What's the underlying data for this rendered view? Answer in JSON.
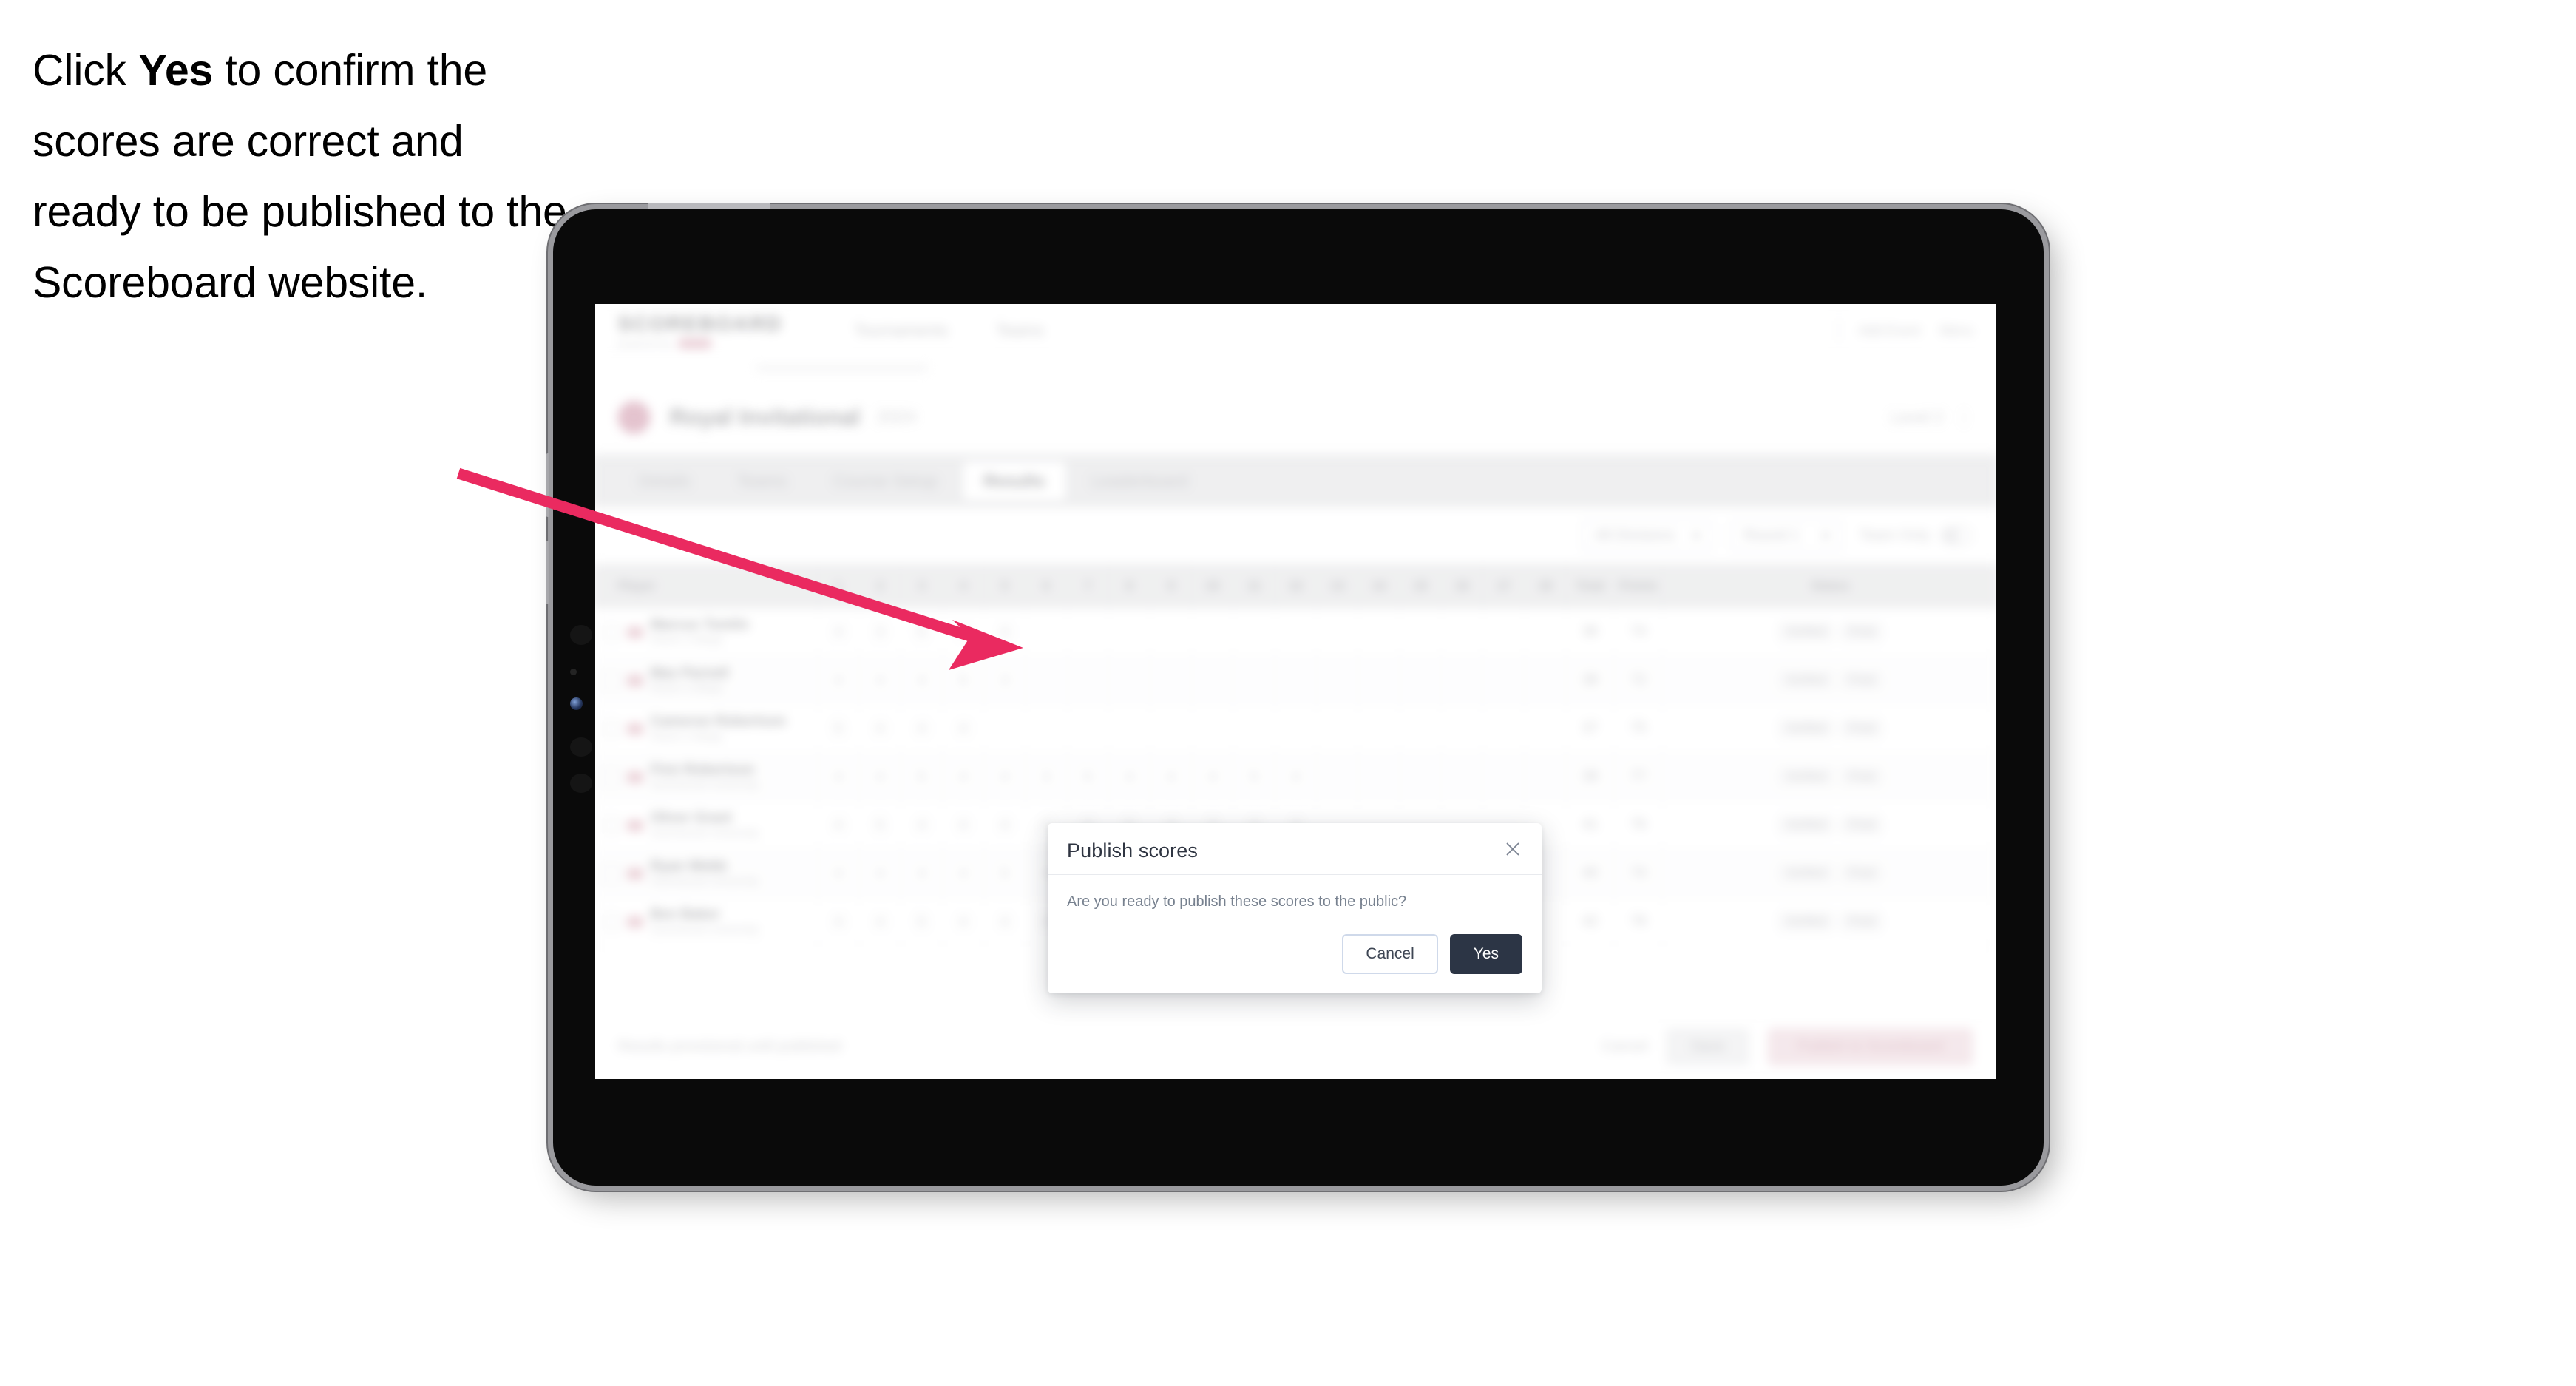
{
  "instruction": {
    "before": "Click ",
    "emphasis": "Yes",
    "after": " to confirm the scores are correct and ready to be published to the Scoreboard website."
  },
  "annotation": {
    "arrow_color": "#EA2A60"
  },
  "device": {
    "type": "tablet",
    "bezel_color": "#0a0a0a",
    "frame_color": "#9a9a9e"
  },
  "app": {
    "brand": {
      "wordmark": "SCOREBOARD",
      "tagline": "powered by",
      "chip_color": "#f47b9e"
    },
    "topnav": [
      {
        "label": "Tournaments"
      },
      {
        "label": "Teams"
      }
    ],
    "topbar_right": [
      {
        "label": "Add Event"
      },
      {
        "label": "Menu"
      }
    ],
    "tournament": {
      "name": "Royal Invitational",
      "date": "2024",
      "right_label": "Level 2",
      "avatar_color": "#f06292"
    },
    "tabs": [
      {
        "label": "Details",
        "active": false
      },
      {
        "label": "Teams",
        "active": false
      },
      {
        "label": "Course Setup",
        "active": false
      },
      {
        "label": "Results",
        "active": true
      },
      {
        "label": "Leaderboard",
        "active": false
      }
    ],
    "filters": {
      "select_one": "All Divisions",
      "select_two": "Round 1",
      "toggle_label": "Team Only",
      "toggle_on": false
    },
    "table": {
      "headers": [
        "Player",
        "1",
        "2",
        "3",
        "4",
        "5",
        "6",
        "7",
        "8",
        "9",
        "10",
        "11",
        "12",
        "13",
        "14",
        "15",
        "16",
        "17",
        "18",
        "Total",
        "Points",
        "Status"
      ],
      "rows": [
        {
          "name": "Marcus Tomlin",
          "team": "Raven College",
          "scores": [
            "4",
            "3",
            "5",
            "4",
            "4",
            "",
            "",
            "",
            "",
            "",
            "",
            "",
            "",
            "",
            "",
            "",
            "",
            ""
          ],
          "total": "36",
          "points": "74",
          "status": [
            "Verified",
            "Final"
          ]
        },
        {
          "name": "Max Parnell",
          "team": "Raven College",
          "scores": [
            "4",
            "4",
            "4",
            "5",
            "3",
            "",
            "",
            "",
            "",
            "",
            "",
            "",
            "",
            "",
            "",
            "",
            "",
            ""
          ],
          "total": "38",
          "points": "72",
          "status": [
            "Verified",
            "Final"
          ]
        },
        {
          "name": "Cameron Robertson",
          "team": "Raven College",
          "scores": [
            "5",
            "4",
            "4",
            "4",
            "",
            "",
            "",
            "",
            "",
            "",
            "",
            "",
            "",
            "",
            "",
            "",
            "",
            ""
          ],
          "total": "37",
          "points": "75",
          "status": [
            "Verified",
            "Final"
          ]
        },
        {
          "name": "Finn Robertson",
          "team": "Summerset University",
          "scores": [
            "4",
            "4",
            "5",
            "4",
            "4",
            "3",
            "5",
            "4",
            "4",
            "4",
            "5",
            "4",
            "",
            "",
            "",
            "",
            "",
            ""
          ],
          "total": "39",
          "points": "77",
          "status": [
            "Verified",
            "Final"
          ]
        },
        {
          "name": "Oliver Grant",
          "team": "Summerset University",
          "scores": [
            "4",
            "5",
            "4",
            "4",
            "4",
            "4",
            "4",
            "5",
            "4",
            "3",
            "4",
            "4",
            "",
            "",
            "",
            "",
            "",
            ""
          ],
          "total": "41",
          "points": "76",
          "status": [
            "Verified",
            "Final"
          ]
        },
        {
          "name": "Ryan Webb",
          "team": "Summerset University",
          "scores": [
            "4",
            "4",
            "4",
            "4",
            "5",
            "4",
            "4",
            "4",
            "4",
            "4",
            "4",
            "4",
            "",
            "",
            "",
            "",
            "",
            ""
          ],
          "total": "40",
          "points": "74",
          "status": [
            "Verified",
            "Final"
          ]
        },
        {
          "name": "Ben Baker",
          "team": "Summerset University",
          "scores": [
            "4",
            "4",
            "5",
            "4",
            "4",
            "4",
            "5",
            "4",
            "4",
            "4",
            "4",
            "4",
            "",
            "",
            "",
            "",
            "",
            ""
          ],
          "total": "42",
          "points": "78",
          "status": [
            "Verified",
            "Final"
          ]
        }
      ]
    },
    "bottom": {
      "note": "Results provisional until published",
      "link": "Cancel",
      "secondary_button": "Save",
      "primary_button": "Publish to Scoreboard"
    }
  },
  "modal": {
    "title": "Publish scores",
    "message": "Are you ready to publish these scores to the public?",
    "cancel_label": "Cancel",
    "confirm_label": "Yes",
    "close_icon": "close-icon",
    "confirm_color": "#2c3545"
  }
}
